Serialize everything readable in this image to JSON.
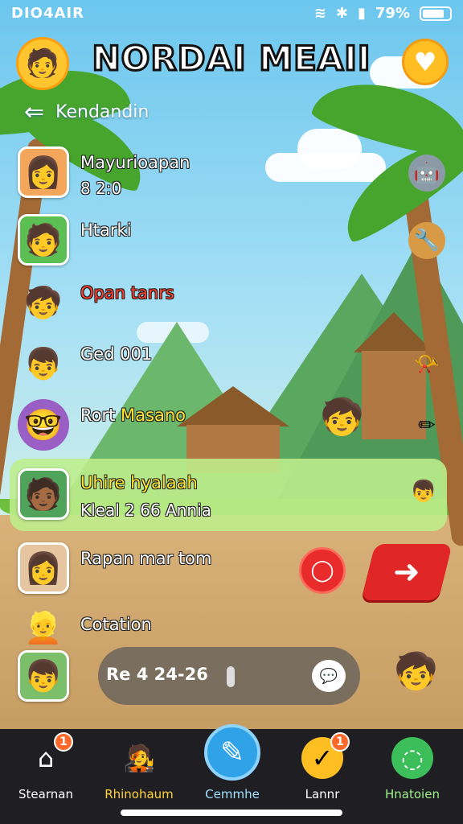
{
  "status_bar": {
    "left_text": "DIO4AIR",
    "battery": "79%"
  },
  "header": {
    "title": "NORDAI MEAII",
    "back_label": "Kendandin"
  },
  "icons": {
    "profile": "profile-avatar-icon",
    "heart": "heart-icon",
    "back": "back-arrow-icon"
  },
  "list": [
    {
      "name": "Mayurioapan",
      "sub": "8 2:0"
    },
    {
      "name": "Htarki",
      "sub": ""
    },
    {
      "name": "Opan tanrs",
      "sub": ""
    },
    {
      "name": "Ged 001",
      "sub": ""
    },
    {
      "name": "Rort Masano",
      "sub": ""
    },
    {
      "name": "Uhire hyalaah",
      "sub": "Kleal 2 66 Annia"
    },
    {
      "name": "Rapan mar tom",
      "sub": ""
    },
    {
      "name": "Cotation",
      "sub": ""
    },
    {
      "name": "Re 4 24-26",
      "sub": ""
    }
  ],
  "nav": [
    {
      "label": "Stearnan",
      "badge": "1"
    },
    {
      "label": "Rhinohaum",
      "badge": ""
    },
    {
      "label": "Cemmhe",
      "badge": ""
    },
    {
      "label": "Lannr",
      "badge": "1"
    },
    {
      "label": "Hnatoien",
      "badge": ""
    }
  ],
  "colors": {
    "accent": "#2fa2e8",
    "danger": "#e02626",
    "nav_bg": "#1f1f23",
    "highlight": "#bfee8c"
  }
}
